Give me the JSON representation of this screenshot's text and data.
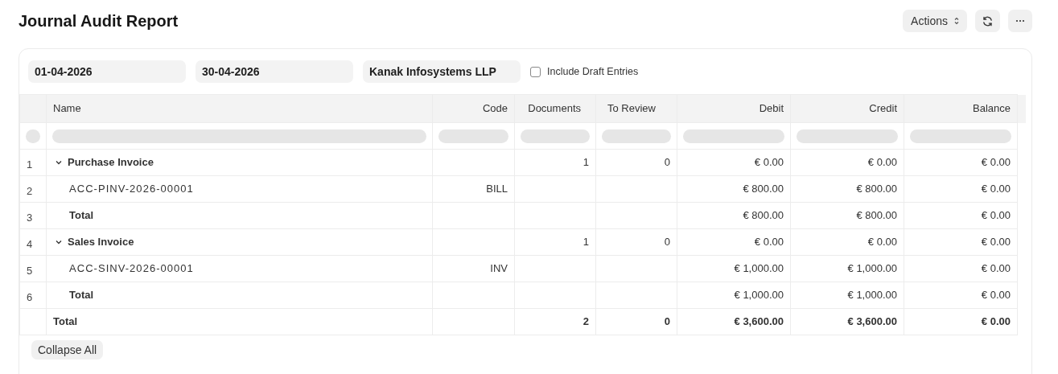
{
  "page": {
    "title": "Journal Audit Report",
    "actions_label": "Actions"
  },
  "filters": {
    "from_date": "01-04-2026",
    "to_date": "30-04-2026",
    "company": "Kanak Infosystems LLP",
    "include_draft": {
      "label": "Include Draft Entries",
      "checked": false
    }
  },
  "table": {
    "columns": [
      "Name",
      "Code",
      "Documents",
      "To Review",
      "Debit",
      "Credit",
      "Balance"
    ],
    "rows": [
      {
        "index": "1",
        "kind": "group",
        "expanded": true,
        "name": "Purchase Invoice",
        "documents": "1",
        "to_review": "0",
        "debit": "€ 0.00",
        "credit": "€ 0.00",
        "balance": "€ 0.00",
        "children": [
          {
            "index": "2",
            "kind": "entry",
            "name": "ACC-PINV-2026-00001",
            "code": "BILL",
            "debit": "€ 800.00",
            "credit": "€ 800.00",
            "balance": "€ 0.00"
          },
          {
            "index": "3",
            "kind": "subtotal",
            "name": "Total",
            "debit": "€ 800.00",
            "credit": "€ 800.00",
            "balance": "€ 0.00"
          }
        ]
      },
      {
        "index": "4",
        "kind": "group",
        "expanded": true,
        "name": "Sales Invoice",
        "documents": "1",
        "to_review": "0",
        "debit": "€ 0.00",
        "credit": "€ 0.00",
        "balance": "€ 0.00",
        "children": [
          {
            "index": "5",
            "kind": "entry",
            "name": "ACC-SINV-2026-00001",
            "code": "INV",
            "debit": "€ 1,000.00",
            "credit": "€ 1,000.00",
            "balance": "€ 0.00"
          },
          {
            "index": "6",
            "kind": "subtotal",
            "name": "Total",
            "debit": "€ 1,000.00",
            "credit": "€ 1,000.00",
            "balance": "€ 0.00"
          }
        ]
      }
    ],
    "total_row": {
      "name": "Total",
      "documents": "2",
      "to_review": "0",
      "debit": "€ 3,600.00",
      "credit": "€ 3,600.00",
      "balance": "€ 0.00"
    }
  },
  "footer": {
    "collapse_label": "Collapse All"
  }
}
